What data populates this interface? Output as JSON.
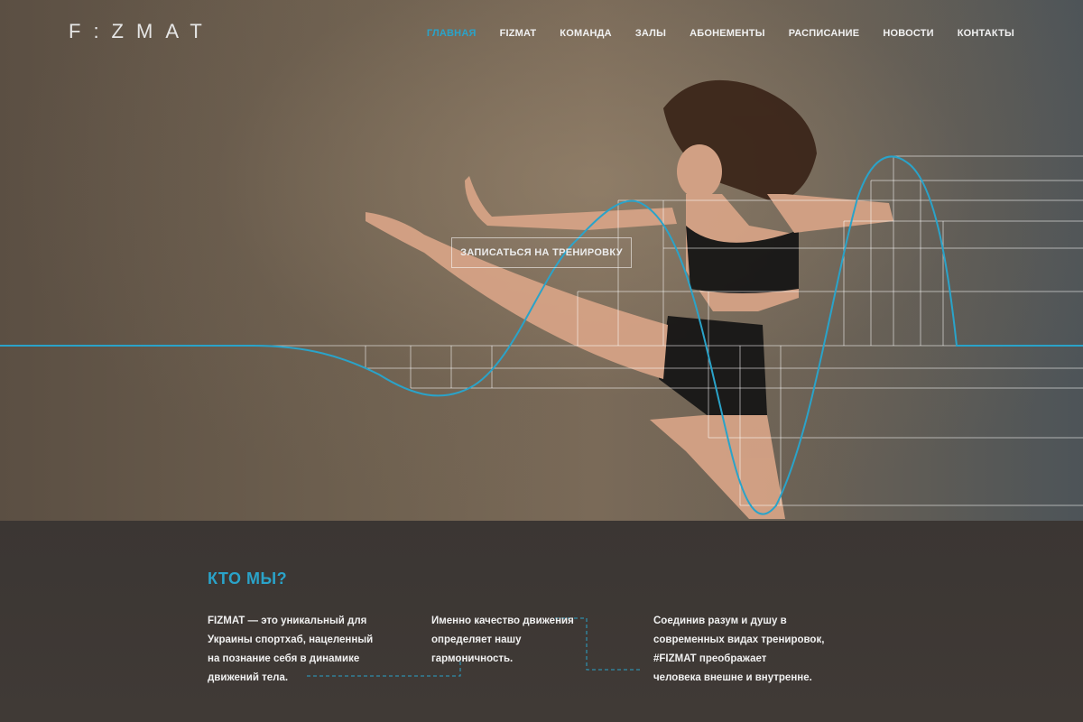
{
  "header": {
    "logo": "F:ZMAT",
    "nav": [
      "ГЛАВНАЯ",
      "FIZMAT",
      "КОМАНДА",
      "ЗАЛЫ",
      "АБОНЕМЕНТЫ",
      "РАСПИСАНИЕ",
      "НОВОСТИ",
      "КОНТАКТЫ"
    ],
    "active_nav": "ГЛАВНАЯ"
  },
  "hero": {
    "cta_label": "ЗАПИСАТЬСЯ НА ТРЕНИРОВКУ",
    "accent_color": "#2aa3c9"
  },
  "about": {
    "title": "КТО МЫ?",
    "col1": [
      "FIZMAT — это уникальный для",
      "Украины спортхаб, нацеленный",
      "на познание себя в динамике",
      "движений тела."
    ],
    "col2": [
      "Именно качество движения",
      "определяет нашу",
      "гармоничность."
    ],
    "col3": [
      "Соединив разум и душу в",
      "современных видах тренировок,",
      "#FIZMAT преображает",
      "человека внешне и внутренне."
    ]
  }
}
